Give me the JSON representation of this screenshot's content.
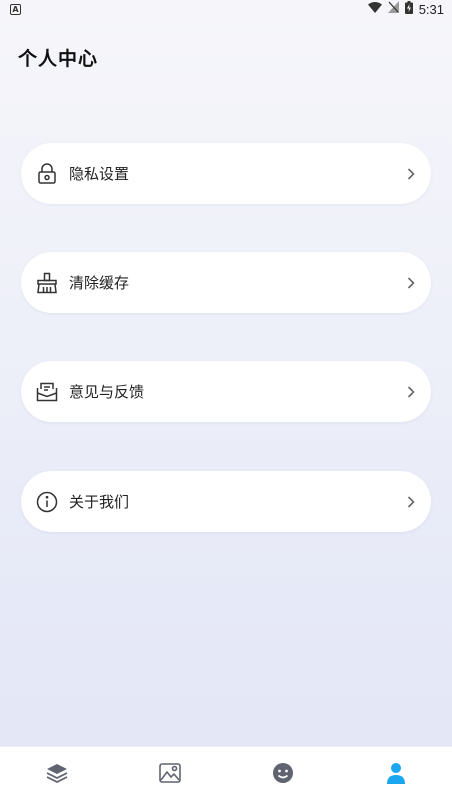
{
  "status_bar": {
    "badge_letter": "A",
    "time": "5:31",
    "icons": [
      "wifi-icon",
      "no-signal-icon",
      "battery-icon"
    ]
  },
  "header": {
    "title": "个人中心"
  },
  "menu": {
    "items": [
      {
        "label": "隐私设置",
        "icon": "lock-icon"
      },
      {
        "label": "清除缓存",
        "icon": "broom-icon"
      },
      {
        "label": "意见与反馈",
        "icon": "feedback-mail-icon"
      },
      {
        "label": "关于我们",
        "icon": "info-icon"
      }
    ]
  },
  "bottom_nav": {
    "items": [
      {
        "icon": "layers-icon",
        "active": false
      },
      {
        "icon": "image-icon",
        "active": false
      },
      {
        "icon": "smiley-icon",
        "active": false
      },
      {
        "icon": "person-icon",
        "active": true
      }
    ],
    "colors": {
      "active": "#1aa7f0",
      "inactive": "#5f6470"
    }
  }
}
